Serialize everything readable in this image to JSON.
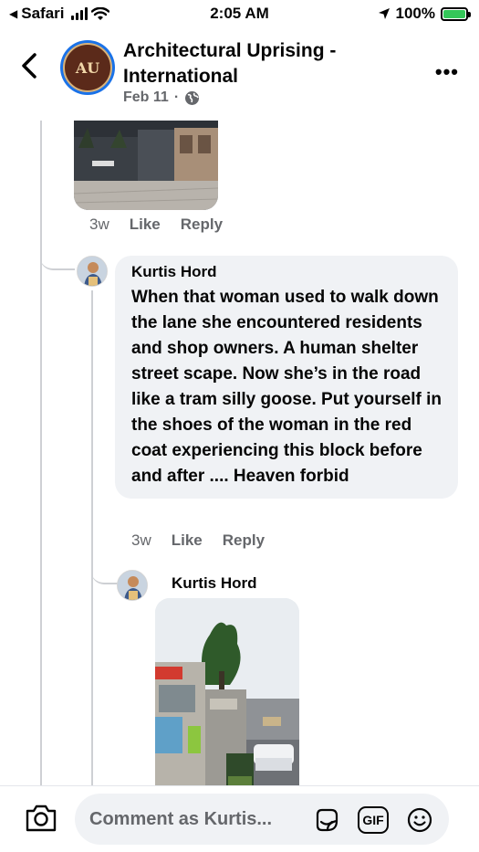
{
  "status_bar": {
    "back_app": "Safari",
    "time": "2:05 AM",
    "battery": "100%"
  },
  "header": {
    "group_name": "Architectural Uprising - International",
    "avatar_text": "AU",
    "post_date": "Feb 11",
    "separator": "·",
    "privacy_icon": "globe-icon"
  },
  "comments": [
    {
      "time": "3w",
      "like_label": "Like",
      "reply_label": "Reply"
    },
    {
      "author": "Kurtis Hord",
      "text": "When that woman used to walk down the lane she encountered residents and shop owners.  A human shelter street scape.  Now she’s in the road like a tram silly goose.  Put yourself in the shoes of the woman in the red coat experiencing this block before and after ....  Heaven forbid",
      "time": "3w",
      "like_label": "Like",
      "reply_label": "Reply"
    },
    {
      "author": "Kurtis Hord"
    }
  ],
  "composer": {
    "placeholder": "Comment as Kurtis...",
    "gif_label": "GIF",
    "icons": [
      "camera-icon",
      "sticker-icon",
      "gif-icon",
      "emoji-icon"
    ]
  },
  "colors": {
    "accent": "#1a72e8",
    "secondary_text": "#65676b",
    "bubble": "#f0f2f5",
    "battery": "#34c759"
  }
}
